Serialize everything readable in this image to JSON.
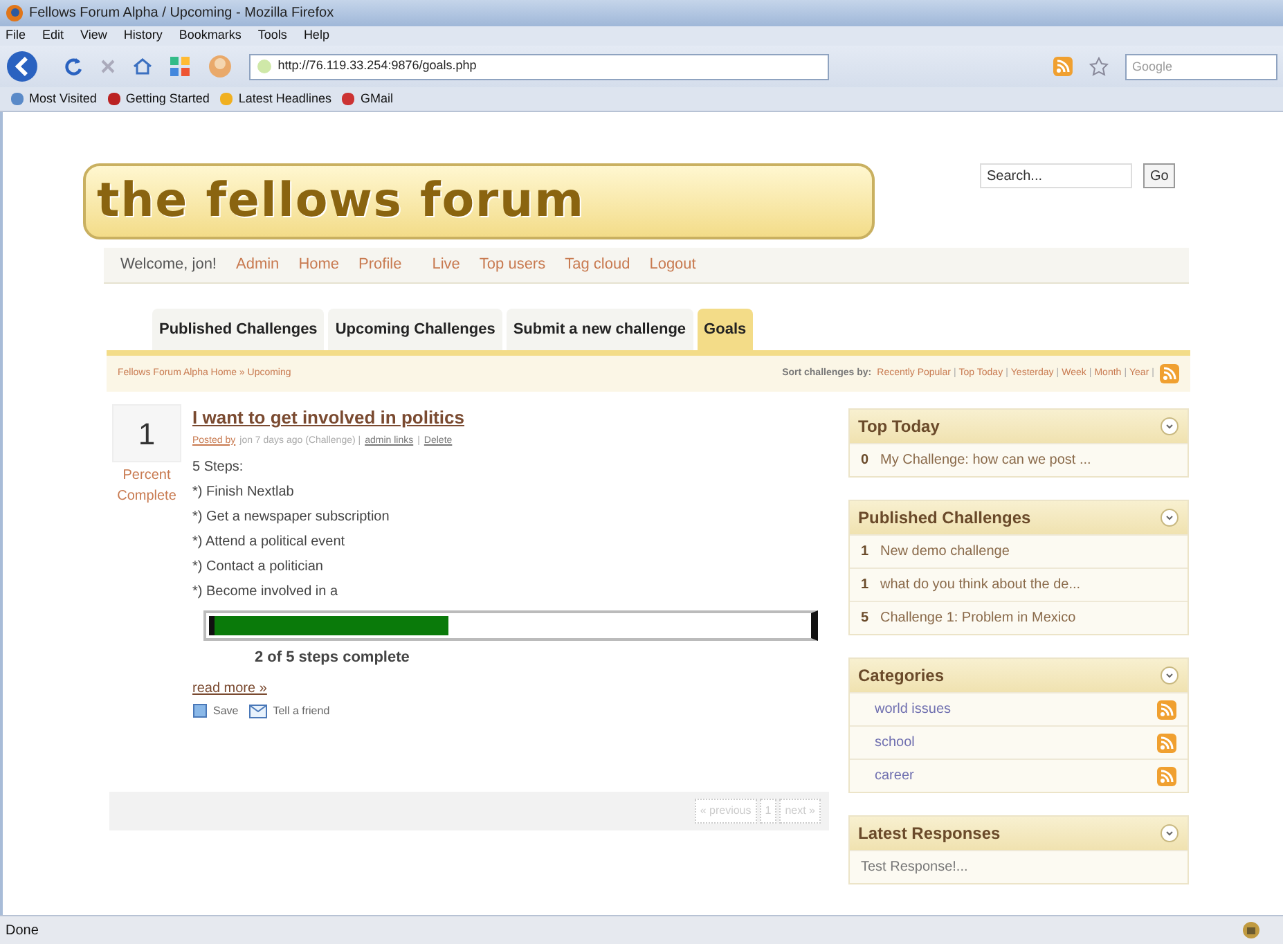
{
  "window": {
    "title": "Fellows Forum Alpha / Upcoming - Mozilla Firefox"
  },
  "menu": [
    "File",
    "Edit",
    "View",
    "History",
    "Bookmarks",
    "Tools",
    "Help"
  ],
  "address": {
    "value": "http://76.119.33.254:9876/goals.php"
  },
  "web_search": {
    "placeholder": "Google"
  },
  "bookmarks": [
    "Most Visited",
    "Getting Started",
    "Latest Headlines",
    "GMail"
  ],
  "site": {
    "logo": "the fellows forum",
    "search": {
      "placeholder": "Search..."
    },
    "search_button": "Go"
  },
  "user_nav": {
    "welcome": "Welcome, jon!",
    "links": [
      "Admin",
      "Home",
      "Profile",
      "Live",
      "Top users",
      "Tag cloud",
      "Logout"
    ]
  },
  "tabs": [
    {
      "label": "Published Challenges",
      "selected": false
    },
    {
      "label": "Upcoming Challenges",
      "selected": false
    },
    {
      "label": "Submit a new challenge",
      "selected": false
    },
    {
      "label": "Goals",
      "selected": true
    }
  ],
  "breadcrumb": "Fellows Forum Alpha Home » Upcoming",
  "sort": {
    "label": "Sort challenges by:",
    "separator": "|",
    "options": [
      "Recently Popular",
      "Top Today",
      "Yesterday",
      "Week",
      "Month",
      "Year"
    ]
  },
  "post": {
    "count": "1",
    "count_label": "Percent Complete",
    "title": "I want to get involved in politics",
    "posted_by": "Posted by",
    "meta": "jon 7 days ago (Challenge) |",
    "admin_links": "admin links",
    "separator": "|",
    "delete": "Delete",
    "steps_heading": "5 Steps:",
    "steps": [
      "*) Finish Nextlab",
      "*) Get a newspaper subscription",
      "*) Attend a political event",
      "*) Contact a politician",
      "*) Become involved in a"
    ],
    "progress": {
      "level": 0.4,
      "caption": "2 of 5 steps complete"
    },
    "read_more": "read more »",
    "save": "Save",
    "tell": "Tell a friend"
  },
  "pagination": [
    "« previous",
    "1",
    "next »"
  ],
  "sidebar": [
    {
      "title": "Top Today",
      "kind": "ranked",
      "items": [
        {
          "count": "0",
          "text": "My Challenge: how can we post ..."
        }
      ]
    },
    {
      "title": "Published Challenges",
      "kind": "ranked",
      "items": [
        {
          "count": "1",
          "text": "New demo challenge"
        },
        {
          "count": "1",
          "text": "what do you think about the de..."
        },
        {
          "count": "5",
          "text": "Challenge 1: Problem in Mexico"
        }
      ]
    },
    {
      "title": "Categories",
      "kind": "feeds",
      "items": [
        {
          "text": "world issues"
        },
        {
          "text": "school"
        },
        {
          "text": "career"
        }
      ]
    },
    {
      "title": "Latest Responses",
      "kind": "plain",
      "items": [
        {
          "text": "Test Response!..."
        }
      ]
    }
  ],
  "status_bar": "Done"
}
